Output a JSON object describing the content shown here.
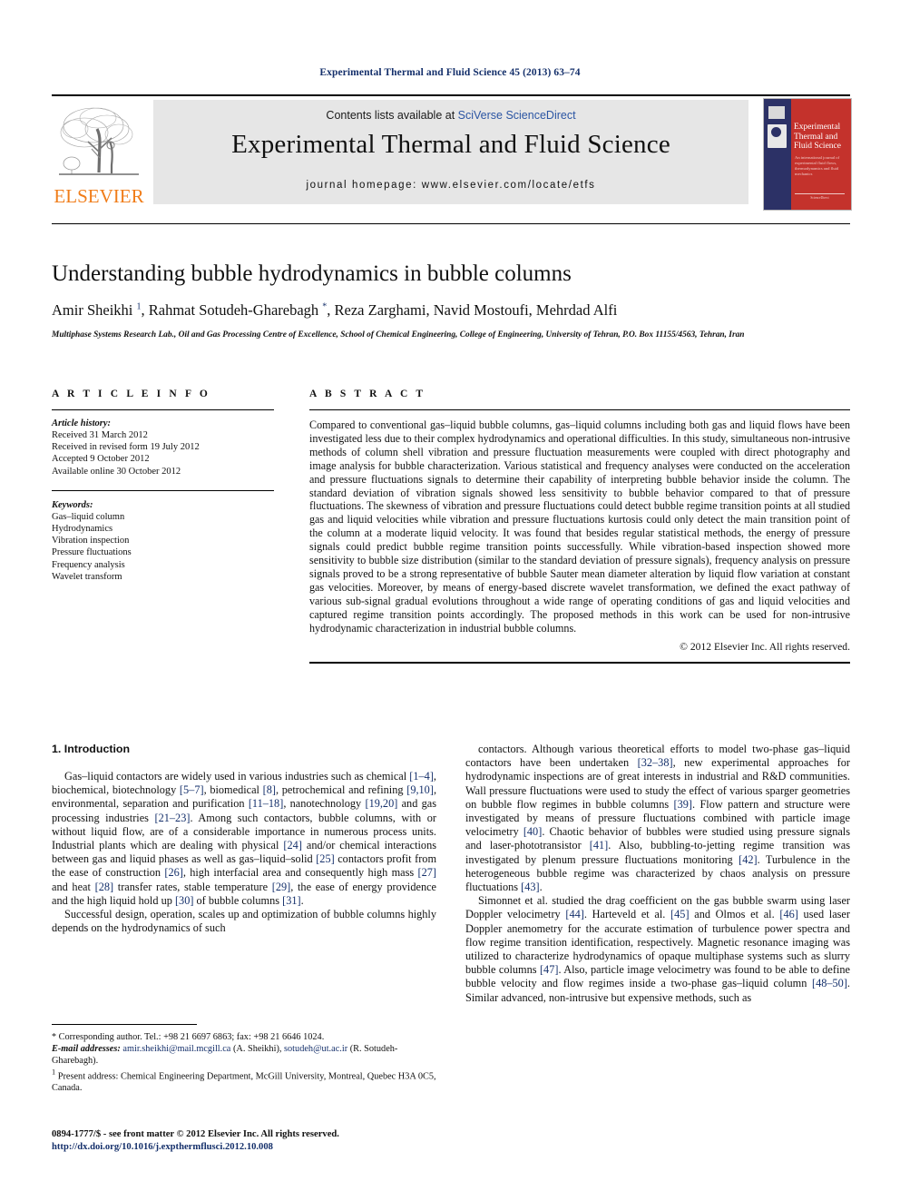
{
  "running_head": "Experimental Thermal and Fluid Science 45 (2013) 63–74",
  "masthead": {
    "contents_prefix": "Contents lists available at ",
    "sciencedirect": "SciVerse ScienceDirect",
    "journal_title": "Experimental Thermal and Fluid Science",
    "homepage": "journal homepage: www.elsevier.com/locate/etfs",
    "publisher_wordmark": "ELSEVIER",
    "cover": {
      "title": "Experimental Thermal and Fluid Science",
      "subtitle": "An international journal of experimental fluid flows, thermodynamics and fluid mechanics",
      "footer": "ScienceDirect"
    },
    "accent_orange": "#f07d1a",
    "link_blue": "#2b55a3",
    "cover_red": "#c4322c",
    "cover_navy": "#2c3166"
  },
  "article": {
    "title": "Understanding bubble hydrodynamics in bubble columns",
    "authors_html": "Amir Sheikhi <sup>1</sup>, Rahmat Sotudeh-Gharebagh <sup>*</sup>, Reza Zarghami, Navid Mostoufi, Mehrdad Alfi",
    "affiliation": "Multiphase Systems Research Lab., Oil and Gas Processing Centre of Excellence, School of Chemical Engineering, College of Engineering, University of Tehran, P.O. Box 11155/4563, Tehran, Iran"
  },
  "article_info": {
    "heading": "A R T I C L E   I N F O",
    "history_label": "Article history:",
    "history": [
      "Received 31 March 2012",
      "Received in revised form 19 July 2012",
      "Accepted 9 October 2012",
      "Available online 30 October 2012"
    ],
    "keywords_label": "Keywords:",
    "keywords": [
      "Gas–liquid column",
      "Hydrodynamics",
      "Vibration inspection",
      "Pressure fluctuations",
      "Frequency analysis",
      "Wavelet transform"
    ]
  },
  "abstract": {
    "heading": "A B S T R A C T",
    "text": "Compared to conventional gas–liquid bubble columns, gas–liquid columns including both gas and liquid flows have been investigated less due to their complex hydrodynamics and operational difficulties. In this study, simultaneous non-intrusive methods of column shell vibration and pressure fluctuation measurements were coupled with direct photography and image analysis for bubble characterization. Various statistical and frequency analyses were conducted on the acceleration and pressure fluctuations signals to determine their capability of interpreting bubble behavior inside the column. The standard deviation of vibration signals showed less sensitivity to bubble behavior compared to that of pressure fluctuations. The skewness of vibration and pressure fluctuations could detect bubble regime transition points at all studied gas and liquid velocities while vibration and pressure fluctuations kurtosis could only detect the main transition point of the column at a moderate liquid velocity. It was found that besides regular statistical methods, the energy of pressure signals could predict bubble regime transition points successfully. While vibration-based inspection showed more sensitivity to bubble size distribution (similar to the standard deviation of pressure signals), frequency analysis on pressure signals proved to be a strong representative of bubble Sauter mean diameter alteration by liquid flow variation at constant gas velocities. Moreover, by means of energy-based discrete wavelet transformation, we defined the exact pathway of various sub-signal gradual evolutions throughout a wide range of operating conditions of gas and liquid velocities and captured regime transition points accordingly. The proposed methods in this work can be used for non-intrusive hydrodynamic characterization in industrial bubble columns.",
    "copyright": "© 2012 Elsevier Inc. All rights reserved."
  },
  "body": {
    "section_heading": "1. Introduction",
    "left_paragraphs": [
      "Gas–liquid contactors are widely used in various industries such as chemical [1–4], biochemical, biotechnology [5–7], biomedical [8], petrochemical and refining [9,10], environmental, separation and purification [11–18], nanotechnology [19,20] and gas processing industries [21–23]. Among such contactors, bubble columns, with or without liquid flow, are of a considerable importance in numerous process units. Industrial plants which are dealing with physical [24] and/or chemical interactions between gas and liquid phases as well as gas–liquid–solid [25] contactors profit from the ease of construction [26], high interfacial area and consequently high mass [27] and heat [28] transfer rates, stable temperature [29], the ease of energy providence and the high liquid hold up [30] of bubble columns [31].",
      "Successful design, operation, scales up and optimization of bubble columns highly depends on the hydrodynamics of such"
    ],
    "right_paragraphs": [
      "contactors. Although various theoretical efforts to model two-phase gas–liquid contactors have been undertaken [32–38], new experimental approaches for hydrodynamic inspections are of great interests in industrial and R&D communities. Wall pressure fluctuations were used to study the effect of various sparger geometries on bubble flow regimes in bubble columns [39]. Flow pattern and structure were investigated by means of pressure fluctuations combined with particle image velocimetry [40]. Chaotic behavior of bubbles were studied using pressure signals and laser-phototransistor [41]. Also, bubbling-to-jetting regime transition was investigated by plenum pressure fluctuations monitoring [42]. Turbulence in the heterogeneous bubble regime was characterized by chaos analysis on pressure fluctuations [43].",
      "Simonnet et al. studied the drag coefficient on the gas bubble swarm using laser Doppler velocimetry [44]. Harteveld et al. [45] and Olmos et al. [46] used laser Doppler anemometry for the accurate estimation of turbulence power spectra and flow regime transition identification, respectively. Magnetic resonance imaging was utilized to characterize hydrodynamics of opaque multiphase systems such as slurry bubble columns [47]. Also, particle image velocimetry was found to be able to define bubble velocity and flow regimes inside a two-phase gas–liquid column [48–50]. Similar advanced, non-intrusive but expensive methods, such as"
    ]
  },
  "footnotes": {
    "corresponding": "Corresponding author. Tel.: +98 21 6697 6863; fax: +98 21 6646 1024.",
    "email_label": "E-mail addresses:",
    "email1": "amir.sheikhi@mail.mcgill.ca",
    "email1_owner": "(A. Sheikhi),",
    "email2": "sotudeh@ut.ac.ir",
    "email2_owner": "(R. Sotudeh-Gharebagh).",
    "present_address": "Present address: Chemical Engineering Department, McGill University, Montreal, Quebec H3A 0C5, Canada.",
    "issn_line": "0894-1777/$ - see front matter © 2012 Elsevier Inc. All rights reserved.",
    "doi": "http://dx.doi.org/10.1016/j.expthermflusci.2012.10.008"
  }
}
